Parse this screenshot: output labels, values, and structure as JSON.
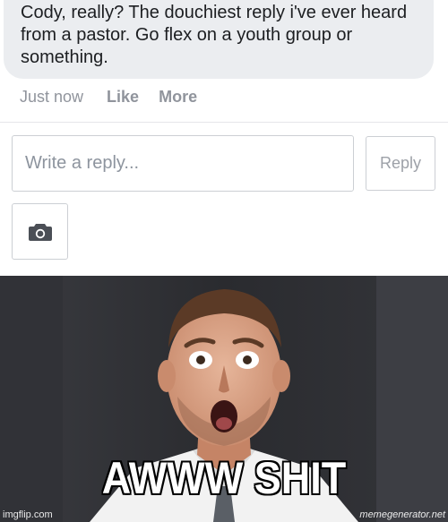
{
  "comment": {
    "text": "Cody, really? The douchiest reply i've ever heard from a pastor. Go flex on a youth group or something.",
    "time": "Just now",
    "like_label": "Like",
    "more_label": "More"
  },
  "reply_box": {
    "placeholder": "Write a reply...",
    "button_label": "Reply",
    "camera_icon": "camera-icon"
  },
  "meme": {
    "caption": "AWWW SHIT",
    "watermark_left": "imgflip.com",
    "watermark_right": "memegenerator.net"
  },
  "colors": {
    "bubble_bg": "#ebedf0",
    "meta_text": "#90949c",
    "camera_icon": "#4b4f56"
  }
}
